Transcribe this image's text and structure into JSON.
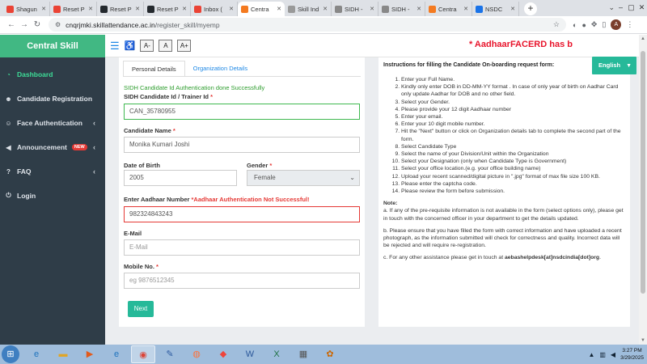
{
  "browser": {
    "tabs": [
      {
        "title": "Shagun",
        "icon": "gmail-icon",
        "color": "#ea4335",
        "active": false
      },
      {
        "title": "Reset P",
        "icon": "gmail-icon",
        "color": "#ea4335",
        "active": false
      },
      {
        "title": "Reset P",
        "icon": "github-icon",
        "color": "#24292e",
        "active": false
      },
      {
        "title": "Reset P",
        "icon": "github-icon",
        "color": "#24292e",
        "active": false
      },
      {
        "title": "Inbox (",
        "icon": "gmail-icon",
        "color": "#ea4335",
        "active": false
      },
      {
        "title": "Centra",
        "icon": "skill-icon",
        "color": "#f47a20",
        "active": true
      },
      {
        "title": "Skill Ind",
        "icon": "page-icon",
        "color": "#999999",
        "active": false
      },
      {
        "title": "SIDH -",
        "icon": "sidh-icon",
        "color": "#888888",
        "active": false
      },
      {
        "title": "SIDH -",
        "icon": "sidh-icon",
        "color": "#888888",
        "active": false
      },
      {
        "title": "Centra",
        "icon": "skill-icon",
        "color": "#f47a20",
        "active": false
      },
      {
        "title": "NSDC",
        "icon": "nsdc-icon",
        "color": "#1a73e8",
        "active": false
      }
    ],
    "url_host": "cnqrjmki.skillattendance.ac.in",
    "url_path": "/register_skill/myemp"
  },
  "sidebar": {
    "brand": "Central Skill",
    "items": [
      {
        "label": "Dashboard",
        "icon": "dashboard-icon",
        "active": true,
        "caret": false,
        "badge": ""
      },
      {
        "label": "Candidate Registration",
        "icon": "user-plus-icon",
        "active": false,
        "caret": false,
        "badge": ""
      },
      {
        "label": "Face Authentication",
        "icon": "face-icon",
        "active": false,
        "caret": true,
        "badge": ""
      },
      {
        "label": "Announcement",
        "icon": "megaphone-icon",
        "active": false,
        "caret": true,
        "badge": "NEW"
      },
      {
        "label": "FAQ",
        "icon": "question-icon",
        "active": false,
        "caret": true,
        "badge": ""
      },
      {
        "label": "Login",
        "icon": "login-icon",
        "active": false,
        "caret": false,
        "badge": ""
      }
    ]
  },
  "topbar": {
    "font_small": "A-",
    "font_normal": "A",
    "font_large": "A+",
    "marquee": "* AadhaarFACERD has b"
  },
  "form": {
    "tab_personal": "Personal Details",
    "tab_org": "Organization Details",
    "success_msg": "SIDH Candidate Id Authentication done Successfully",
    "candidate_id_label": "SIDH Candidate Id / Trainer Id",
    "candidate_id_value": "CAN_35780955",
    "name_label": "Candidate Name",
    "name_value": "Monika Kumari Joshi",
    "dob_label": "Date of Birth",
    "dob_value": "2005",
    "gender_label": "Gender",
    "gender_value": "Female",
    "aadhaar_label": "Enter Aadhaar Number",
    "aadhaar_error": "*Aadhaar Authentication Not Successful!",
    "aadhaar_value": "982324843243",
    "email_label": "E-Mail",
    "email_placeholder": "E-Mail",
    "mobile_label": "Mobile No.",
    "mobile_placeholder": "eg 9876512345",
    "required_mark": "*",
    "next_label": "Next"
  },
  "instructions": {
    "heading": "Instructions for filling the Candidate On-boarding request form:",
    "steps": [
      "Enter your Full Name.",
      "Kindly only enter DOB in DD-MM-YY format . In case of only year of birth on Aadhar Card only update Aadhar for DOB and no other field.",
      "Select your Gender.",
      "Please provide your 12 digit Aadhaar number",
      "Enter your email.",
      "Enter your 10 digit mobile number.",
      "Hit the \"Next\" button or click on Organization details tab to complete the second part of the form.",
      "Select Candidate Type",
      "Select the name of your Division/Unit within the Organization",
      "Select your Designation (only when Candidate Type is Government)",
      "Select your office location.(e.g. your office building name)",
      "Upload your recent scanned/digital picture in \".jpg\" format of max file size 100 KB.",
      "Please enter the captcha code.",
      "Please review the form before submission."
    ],
    "note_label": "Note:",
    "note_a": "a. If any of the pre-requisite information is not available in the form (select options only), please get in touch with the concerned officer in your department to get the details updated.",
    "note_b": "b. Please ensure that you have filled the form with correct information and have uploaded a recent photograph, as the information submitted will check for correctness and quality. Incorrect data will be rejected and will require re-registration.",
    "note_c_prefix": "c. For any other assistance please get in touch at ",
    "note_c_email": "aebashelpdesk[at]nsdcindia[dot]org",
    "note_c_suffix": "."
  },
  "language": {
    "label": "English"
  },
  "taskbar": {
    "apps": [
      {
        "name": "ie-icon",
        "glyph": "e",
        "color": "#1e73be"
      },
      {
        "name": "folder-icon",
        "glyph": "▬",
        "color": "#e0a526"
      },
      {
        "name": "media-icon",
        "glyph": "▶",
        "color": "#e25a1c"
      },
      {
        "name": "ie2-icon",
        "glyph": "e",
        "color": "#1e73be"
      },
      {
        "name": "chrome-icon",
        "glyph": "◉",
        "color": "#db4437"
      },
      {
        "name": "tool-icon",
        "glyph": "✎",
        "color": "#2c5aa0"
      },
      {
        "name": "firefox-icon",
        "glyph": "◍",
        "color": "#ff7139"
      },
      {
        "name": "anydesk-icon",
        "glyph": "◆",
        "color": "#ef443b"
      },
      {
        "name": "word-icon",
        "glyph": "W",
        "color": "#2b579a"
      },
      {
        "name": "excel-icon",
        "glyph": "X",
        "color": "#217346"
      },
      {
        "name": "calculator-icon",
        "glyph": "▦",
        "color": "#555555"
      },
      {
        "name": "paint-icon",
        "glyph": "✿",
        "color": "#cc6600"
      }
    ],
    "time": "3:27 PM",
    "date": "3/29/2025"
  }
}
